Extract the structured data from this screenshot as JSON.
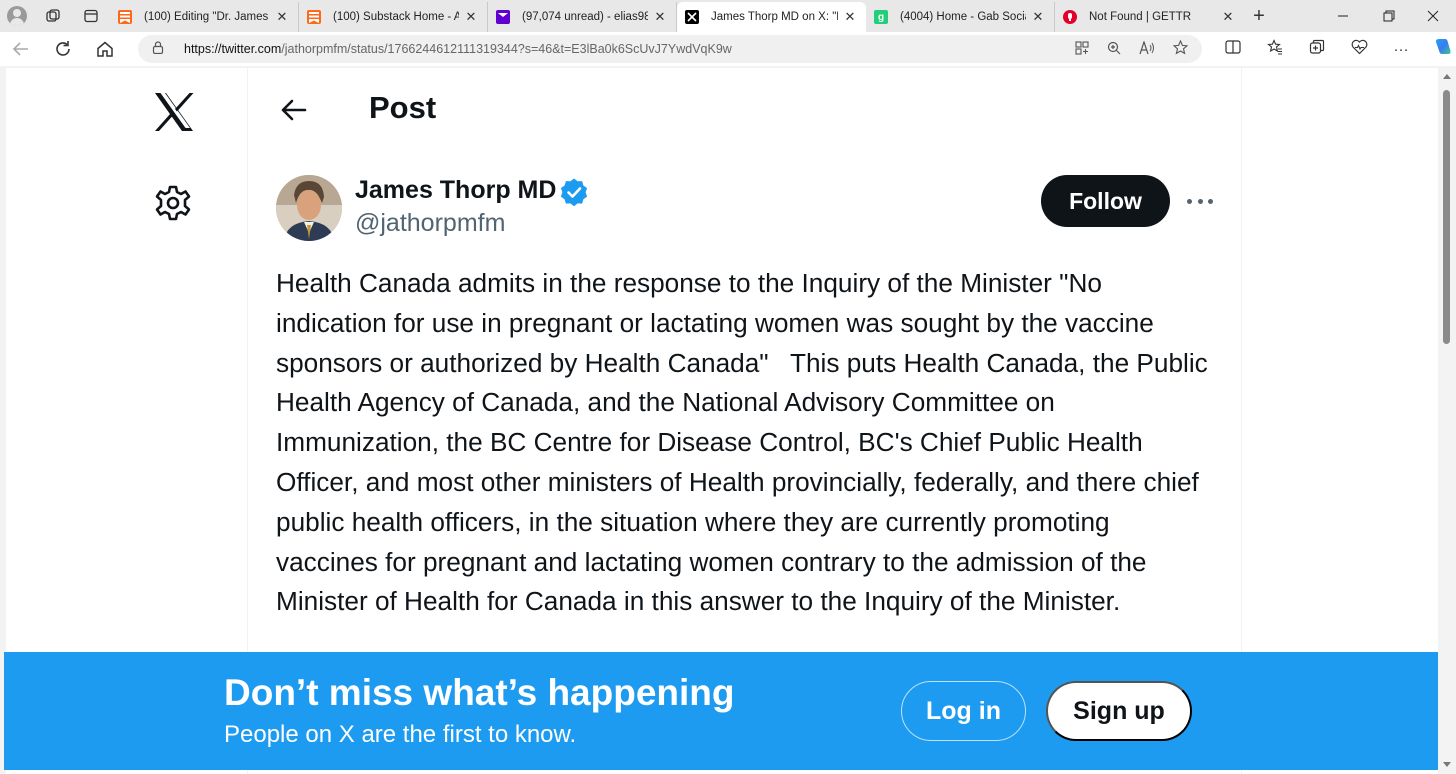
{
  "browser": {
    "tabs": [
      {
        "title": "(100) Editing \"Dr. James Th",
        "favicon": "substack-icon",
        "color": "#ff6719",
        "active": false
      },
      {
        "title": "(100) Substack Home - All",
        "favicon": "substack-icon",
        "color": "#ff6719",
        "active": false
      },
      {
        "title": "(97,074 unread) - elias98",
        "favicon": "mail-icon",
        "color": "#6001d2",
        "active": false
      },
      {
        "title": "James Thorp MD on X: \"H",
        "favicon": "x-icon",
        "color": "#000000",
        "active": true
      },
      {
        "title": "(4004) Home - Gab Social",
        "favicon": "gab-icon",
        "color": "#21cf7a",
        "active": false
      },
      {
        "title": "Not Found | GETTR",
        "favicon": "gettr-icon",
        "color": "#e4002b",
        "active": false
      }
    ],
    "url_host": "https://twitter.com",
    "url_path": "/jathorpmfm/status/1766244612111319344?s=46&t=E3lBa0k6ScUvJ7YwdVqK9w"
  },
  "page": {
    "header_title": "Post",
    "author": {
      "name": "James Thorp MD",
      "handle": "@jathorpmfm",
      "verified": true
    },
    "follow_label": "Follow",
    "tweet_text": "Health Canada admits in the response to the Inquiry of the Minister \"No indication for use in pregnant or lactating women was sought by the vaccine sponsors or authorized by Health Canada\"   This puts Health Canada, the Public Health Agency of Canada, and the National Advisory Committee on Immunization, the BC Centre for Disease Control, BC's Chief Public Health Officer, and most other ministers of Health provincially, federally, and there chief public health officers, in the situation where they are currently promoting vaccines for pregnant and lactating women contrary to the admission of the Minister of Health for Canada in this answer to the Inquiry of the Minister."
  },
  "banner": {
    "title": "Don’t miss what’s happening",
    "subtitle": "People on X are the first to know.",
    "login_label": "Log in",
    "signup_label": "Sign up"
  },
  "colors": {
    "x_blue": "#1d9bf0",
    "text_primary": "#0f1419",
    "text_secondary": "#536471"
  }
}
